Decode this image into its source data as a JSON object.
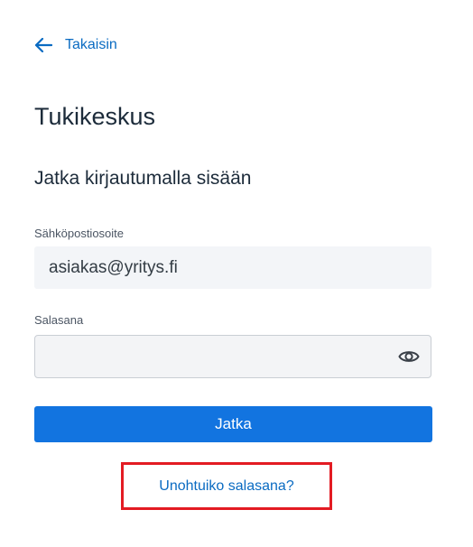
{
  "nav": {
    "back_label": "Takaisin",
    "back_icon": "arrow-left-icon"
  },
  "header": {
    "title": "Tukikeskus",
    "subtitle": "Jatka kirjautumalla sisään"
  },
  "form": {
    "email_label": "Sähköpostiosoite",
    "email_value": "asiakas@yritys.fi",
    "password_label": "Salasana",
    "password_value": "",
    "password_toggle_icon": "eye-icon",
    "submit_label": "Jatka",
    "forgot_label": "Unohtuiko salasana?"
  },
  "colors": {
    "link": "#0a6bc2",
    "primary_button": "#1274e0",
    "highlight": "#e31b23"
  }
}
